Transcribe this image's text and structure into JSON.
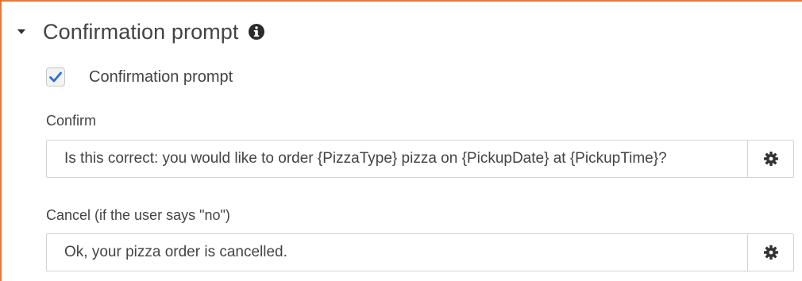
{
  "section": {
    "title": "Confirmation prompt",
    "toggle_icon": "caret-down-icon",
    "info_icon": "info-icon"
  },
  "checkbox": {
    "label": "Confirmation prompt",
    "checked": true,
    "check_color": "#2d6fd1"
  },
  "confirm": {
    "label": "Confirm",
    "value": "Is this correct: you would like to order {PizzaType} pizza on {PickupDate} at {PickupTime}?",
    "settings_icon": "gear-icon"
  },
  "cancel": {
    "label": "Cancel (if the user says \"no\")",
    "value": "Ok, your pizza order is cancelled.",
    "settings_icon": "gear-icon"
  },
  "colors": {
    "accent_border": "#e5793b",
    "text": "#444444"
  }
}
